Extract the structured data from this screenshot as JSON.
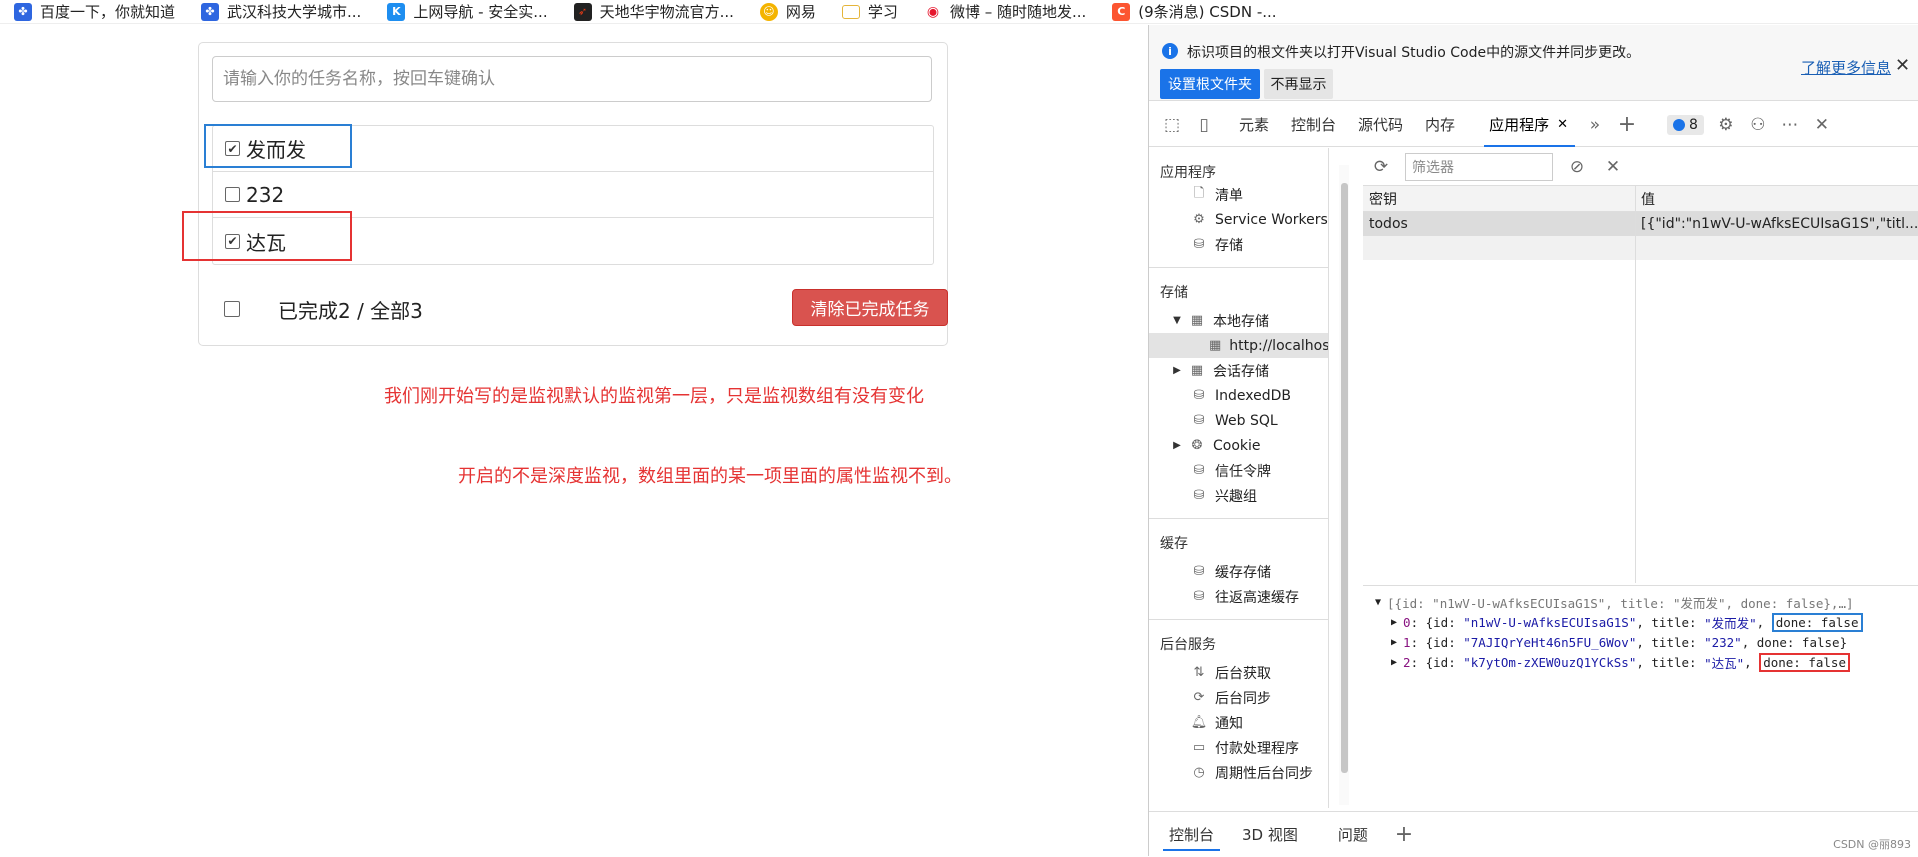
{
  "bookmarks": [
    {
      "label": "百度一下，你就知道",
      "icon": "paw-icon",
      "color": "#2e66e0"
    },
    {
      "label": "武汉科技大学城市...",
      "icon": "paw-icon",
      "color": "#2e66e0"
    },
    {
      "label": "上网导航 - 安全实...",
      "icon": "k-icon",
      "color": "#1e8ef0"
    },
    {
      "label": "天地华宇物流官方...",
      "icon": "arrow-logo-icon",
      "color": "#e23a16"
    },
    {
      "label": "网易",
      "icon": "netease-icon",
      "color": "#f4b400"
    },
    {
      "label": "学习",
      "icon": "folder-icon",
      "color": "#e5b53a"
    },
    {
      "label": "微博 – 随时随地发...",
      "icon": "weibo-icon",
      "color": "#e6162d"
    },
    {
      "label": "(9条消息) CSDN -...",
      "icon": "csdn-icon",
      "color": "#fc5531"
    }
  ],
  "todo": {
    "input_placeholder": "请输入你的任务名称，按回车键确认",
    "items": [
      {
        "title": "发而发",
        "checked": true
      },
      {
        "title": "232",
        "checked": false
      },
      {
        "title": "达瓦",
        "checked": true
      }
    ],
    "footer_text": "已完成2 / 全部3",
    "clear_button": "清除已完成任务"
  },
  "notes": {
    "line1": "我们刚开始写的是监视默认的监视第一层，只是监视数组有没有变化",
    "line2": "开启的不是深度监视，数组里面的某一项里面的属性监视不到。"
  },
  "devtools": {
    "infobar": {
      "text": "标识项目的根文件夹以打开Visual Studio Code中的源文件并同步更改。",
      "link": "了解更多信息",
      "primary_button": "设置根文件夹",
      "secondary_button": "不再显示"
    },
    "tabs": [
      "元素",
      "控制台",
      "源代码",
      "内存",
      "应用程序"
    ],
    "active_tab": "应用程序",
    "issues_count": "8",
    "sidebar": {
      "app_section": "应用程序",
      "app_items": [
        "清单",
        "Service Workers",
        "存储"
      ],
      "storage_section": "存储",
      "local_storage": "本地存储",
      "local_origin": "http://localhost:",
      "session_storage": "会话存储",
      "storage_items": [
        "IndexedDB",
        "Web SQL"
      ],
      "cookie": "Cookie",
      "storage_items2": [
        "信任令牌",
        "兴趣组"
      ],
      "cache_section": "缓存",
      "cache_items": [
        "缓存存储",
        "往返高速缓存"
      ],
      "bg_section": "后台服务",
      "bg_items": [
        "后台获取",
        "后台同步",
        "通知",
        "付款处理程序",
        "周期性后台同步"
      ]
    },
    "filter_placeholder": "筛选器",
    "grid": {
      "col_key": "密钥",
      "col_value": "值",
      "row_key": "todos",
      "row_value": "[{\"id\":\"n1wV-U-wAfksECUIsaG1S\",\"titl..."
    },
    "preview": {
      "summary": "[{id: \"n1wV-U-wAfksECUIsaG1S\", title: \"发而发\", done: false},…]",
      "rows": [
        {
          "idx": "0",
          "id": "\"n1wV-U-wAfksECUIsaG1S\"",
          "title": "\"发而发\"",
          "done": "done: false"
        },
        {
          "idx": "1",
          "id": "\"7AJIQrYeHt46n5FU_6Wov\"",
          "title": "\"232\"",
          "done": "done: false"
        },
        {
          "idx": "2",
          "id": "\"k7ytOm-zXEW0uzQ1YCkSs\"",
          "title": "\"达瓦\"",
          "done": "done: false"
        }
      ]
    },
    "drawer_tabs": [
      "控制台",
      "3D 视图",
      "问题"
    ],
    "watermark": "CSDN @丽893"
  }
}
